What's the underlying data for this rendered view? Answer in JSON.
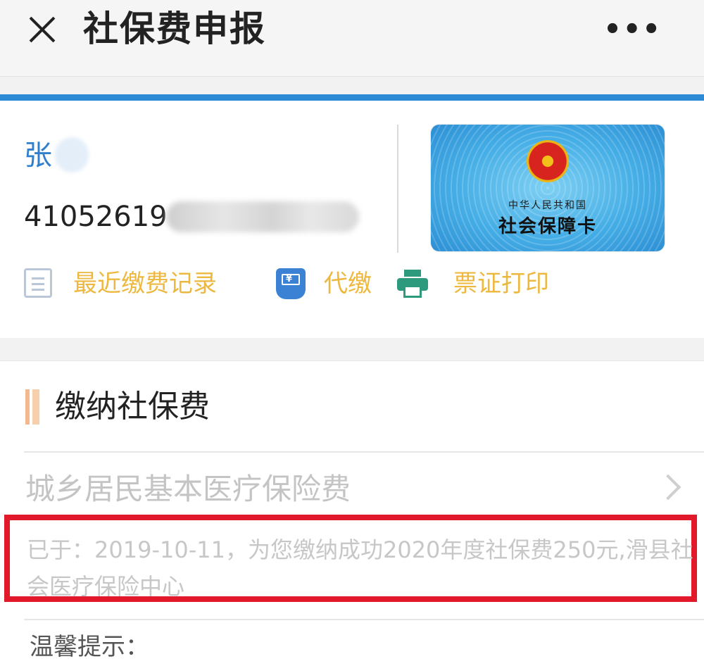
{
  "header": {
    "title": "社保费申报",
    "more_label": "•••"
  },
  "account": {
    "name": "张",
    "id_number": "41052619",
    "card": {
      "sub_text": "中华人民共和国",
      "main_text": "社会保障卡"
    }
  },
  "actions": [
    {
      "label": "最近缴费记录",
      "icon": "list-icon"
    },
    {
      "label": "代缴",
      "icon": "payment-hand-icon"
    },
    {
      "label": "票证打印",
      "icon": "printer-icon"
    }
  ],
  "section": {
    "title": "缴纳社保费",
    "item_title": "城乡居民基本医疗保险费",
    "notice": "已于：2019-10-11，为您缴纳成功2020年度社保费250元,滑县社会医疗保险中心",
    "tip": "温馨提示："
  },
  "colors": {
    "accent_blue": "#2e8ad6",
    "name_blue": "#2f7fcd",
    "action_gold": "#ecb83f",
    "highlight_red": "#e2192a"
  }
}
